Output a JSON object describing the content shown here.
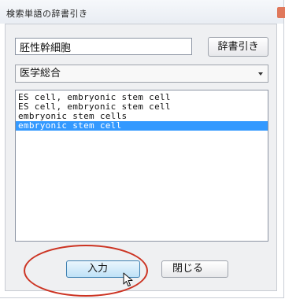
{
  "window": {
    "title": "検索単語の辞書引き"
  },
  "search": {
    "value": "胚性幹細胞",
    "lookup_label": "辞書引き"
  },
  "dictionary": {
    "selected": "医学総合"
  },
  "results": {
    "items": [
      "ES cell, embryonic stem cell",
      "ES cell, embryonic stem cell",
      "embryonic stem cells",
      "embryonic stem cell"
    ],
    "selected_index": 3
  },
  "buttons": {
    "input_label": "入力",
    "close_label": "閉じる"
  },
  "colors": {
    "selection": "#3399ff",
    "annotation": "#cc3322",
    "default_button_border": "#3c7fb1"
  },
  "icons": {
    "cursor": "mouse-pointer-icon"
  }
}
